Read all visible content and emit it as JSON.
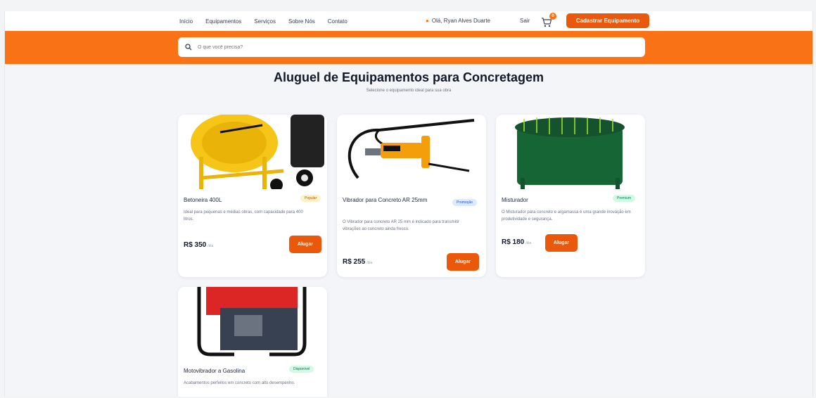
{
  "nav": {
    "links": [
      "Início",
      "Equipamentos",
      "Serviços",
      "Sobre Nós",
      "Contato"
    ],
    "greeting": "Olá, Ryan Alves Duarte",
    "logout": "Sair",
    "cart_count": "0",
    "cta_label": "Cadastrar Equipamento"
  },
  "search": {
    "placeholder": "O que você precisa?"
  },
  "page": {
    "title": "Aluguel de Equipamentos para Concretagem",
    "subtitle": "Selecione o equipamento ideal para sua obra"
  },
  "products": [
    {
      "name": "Betoneira 400L",
      "badge": "Popular",
      "description": "Ideal para pequenas e médias obras, com capacidade para 400 litros.",
      "price": "R$ 350",
      "per": "/dia",
      "button": "Alugar"
    },
    {
      "name": "Vibrador para Concreto AR 25mm",
      "badge": "Promoção",
      "description": "O Vibrador para concreto AR 25 mm é indicado para transmitir vibrações ao concreto ainda fresco.",
      "price": "R$ 255",
      "per": "/dia",
      "button": "Alugar"
    },
    {
      "name": "Misturador",
      "badge": "Premium",
      "description": "O Misturador para concreto e argamassa é uma grande inovação em produtividade e segurança.",
      "price": "R$ 180",
      "per": "/dia",
      "button": "Alugar"
    },
    {
      "name": "Motovibrador a Gasolina",
      "badge": "Disponível",
      "description": "Acabamentos perfeitos em concreto com alto desempenho.",
      "price": "",
      "per": "",
      "button": ""
    }
  ],
  "colors": {
    "brand": "#f97316",
    "button": "#ea580c"
  }
}
